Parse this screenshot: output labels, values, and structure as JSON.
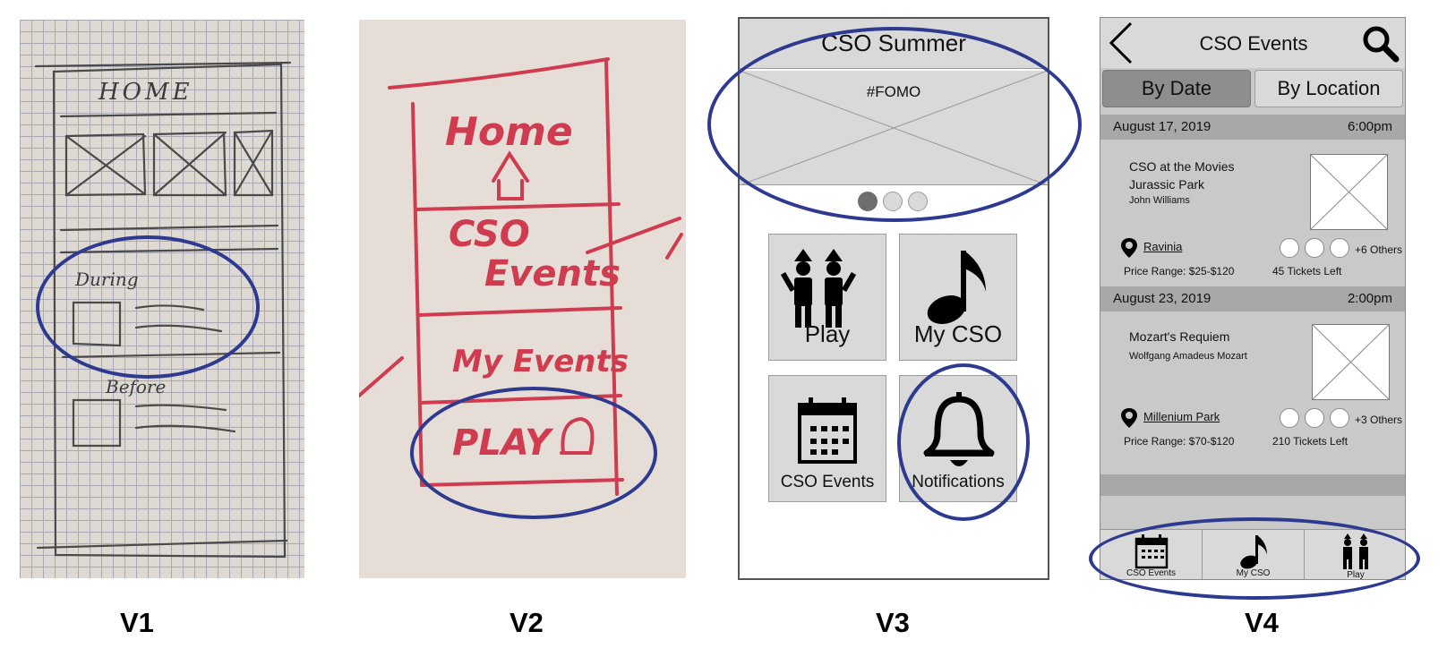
{
  "v1": {
    "title": "HOME",
    "during_label": "During",
    "before_label": "Before"
  },
  "v2": {
    "home_label": "Home",
    "events_line1": "CSO",
    "events_line2": "Events",
    "my_events_label": "My Events",
    "play_label": "PLAY"
  },
  "v3": {
    "title": "CSO Summer",
    "banner_text": "#FOMO",
    "tiles": [
      {
        "label": "Play",
        "icon": "people-icon"
      },
      {
        "label": "My CSO",
        "icon": "music-note-icon"
      },
      {
        "label": "CSO Events",
        "icon": "calendar-icon"
      },
      {
        "label": "Notifications",
        "icon": "bell-icon"
      }
    ]
  },
  "v4": {
    "title": "CSO Events",
    "tabs": [
      "By Date",
      "By Location"
    ],
    "events": [
      {
        "date": "August  17, 2019",
        "time": "6:00pm",
        "line1": "CSO at the Movies",
        "line2": "Jurassic Park",
        "line3": "John Williams",
        "location": "Ravinia",
        "others": "+6 Others",
        "price": "Price Range: $25-$120",
        "tickets": "45 Tickets Left"
      },
      {
        "date": "August 23, 2019",
        "time": "2:00pm",
        "line1": "Mozart's Requiem",
        "line2": "Wolfgang Amadeus Mozart",
        "location": "Millenium Park",
        "others": "+3 Others",
        "price": "Price Range: $70-$120",
        "tickets": "210 Tickets Left"
      }
    ],
    "nav": [
      "CSO Events",
      "My CSO",
      "Play"
    ]
  },
  "labels": [
    "V1",
    "V2",
    "V3",
    "V4"
  ],
  "colors": {
    "highlight_oval": "#2e3a8f",
    "marker_red": "#cf3b4f",
    "wireframe_gray": "#d9d9d9"
  }
}
